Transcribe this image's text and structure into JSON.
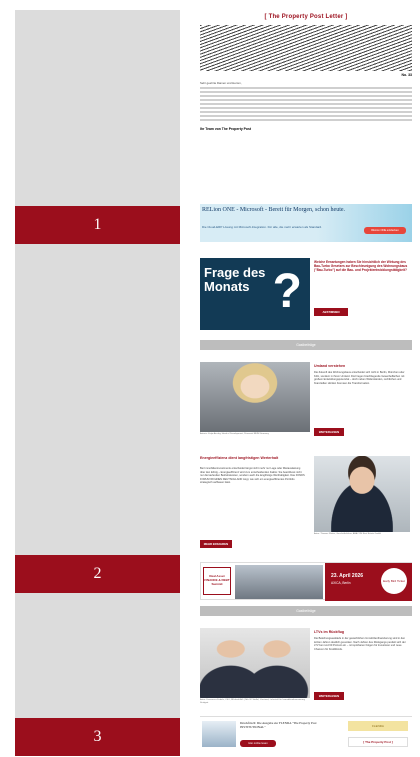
{
  "markers": [
    "1",
    "2",
    "3"
  ],
  "newsletter": {
    "masthead": "[ The Property Post Letter ]",
    "issue_no": "No. 33",
    "salutation": "Sehr geehrte Damen und Herren,",
    "team_signoff": "Ihr Team von The Property Post",
    "banner1": {
      "headline": "RELion ONE - Microsoft - Bereit für Morgen, schon heute.",
      "sub": "Die Cloud-ERP Lösung mit Microsoft-Integration. Für alle, die mehr erwarten als Standard.",
      "button": "RELion ONE entdecken"
    },
    "frage": {
      "title": "Frage des Monats",
      "question_mark": "?",
      "text": "Welche Erwartungen haben Sie hinsichtlich der Wirkung des Bau-Turbo Gesetzes zur Beschleunigung des Wohnungsbaus (\"Bau-Turbo\") auf die Bau- und Projektentwicklungstätigkeit?",
      "button": "ABSTIMMEN"
    },
    "section_label": "Gastbeiträge",
    "article1": {
      "headline": "Umland verstehen",
      "body": "Die Zukunft des Wohnungsbaus entscheidet sich nicht in Berlin, München oder Köln, sondern in ihrem Umland. Dort liegen brachliegende Gewerbeflächen mit großem Entwicklungspotenzial – doch neben Widerständen, rechtlichen und finanziellen Hürden bremsen die Transformation.",
      "caption": "Autorin: Katja Ainsley, Head of Development, Primonial REIM Germany",
      "button": "WEITERLESEN"
    },
    "article2": {
      "headline": "Energieeffizienz dient langfristigen Werterhalt",
      "body": "Bei Immobilieninvestments entscheidet längst nicht mehr nur Lage oder Mietauslastung über den Erfolg – Energieeffizienz wird zum entscheidenden Faktor. Sie beeinflusst nicht nur die laufenden Betriebskosten, sondern auch die langfristige Werthaltigkeit. Das FONDS FORUM WOHNEN DEUTSCHLAND zeigt, wie sich ein energieeffizientes Portfolio strategisch aufbauen lässt.",
      "caption": "Autor: Thomas Winter, Geschäftsführer, ABACON Real Estate GmbH",
      "button": "MEHR ERFAHREN"
    },
    "event": {
      "logo_text": "Real Asset FINANCE & DEBT Summit",
      "date": "23. April 2026",
      "place": "AXICA, Berlin",
      "badge": "Early Bird Ticket"
    },
    "article3": {
      "headline": "LTVs im Rückflug",
      "body": "Die Beleihungsausläufe in der gewerblichen Immobilienfinanzierung sind in den letzten Jahren deutlich gesunken. Nach Jahren des Rückgangs pendelt sich der LTV bei rund 60 Prozent ein – mit spürbaren Folgen für Investoren und neue Chancen für Kreditfonds.",
      "caption": "Autor: Francesco Fedele, CEO, BF.direkt AG | Nils W. Stoffel, Vorstand, Lehrstuhl für Immobilienfinanzierung Stuttgart",
      "button": "WEITERLESEN"
    },
    "finance": {
      "title": "Druckfrisch: Die Ausgabe zur FLENDA \"The Property Post INSTITUTIONAL\"",
      "button": "Hier online lesen",
      "logo": "FLENDA",
      "brand": "[ The Property Post ]"
    }
  }
}
